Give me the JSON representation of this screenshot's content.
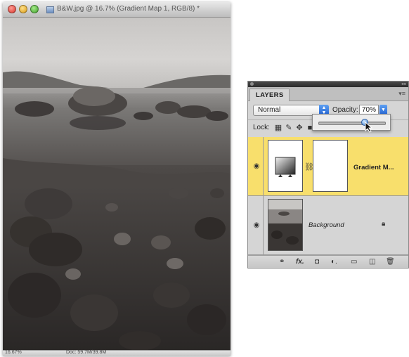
{
  "document": {
    "title": "B&W.jpg @ 16.7% (Gradient Map 1, RGB/8) *",
    "status_zoom": "16.67%",
    "status_info": "Doc: 59.7M/39.8M"
  },
  "layers_panel": {
    "tab_label": "LAYERS",
    "menu_icon": "panel-menu-icon",
    "blend_mode": "Normal",
    "opacity_label": "Opacity:",
    "opacity_value": "70%",
    "opacity_fraction": 0.7,
    "lock_label": "Lock:",
    "layers": [
      {
        "name": "Gradient M...",
        "selected": true,
        "visible": true
      },
      {
        "name": "Background",
        "selected": false,
        "visible": true,
        "locked": true
      }
    ],
    "footer_icons": [
      "link-layers-icon",
      "fx-icon",
      "add-mask-icon",
      "adjustment-layer-icon",
      "new-group-icon",
      "new-layer-icon",
      "trash-icon"
    ]
  },
  "colors": {
    "selected_layer": "#f8df6c",
    "panel_bg": "#d5d5d5",
    "accent_blue": "#1f5fd0"
  }
}
